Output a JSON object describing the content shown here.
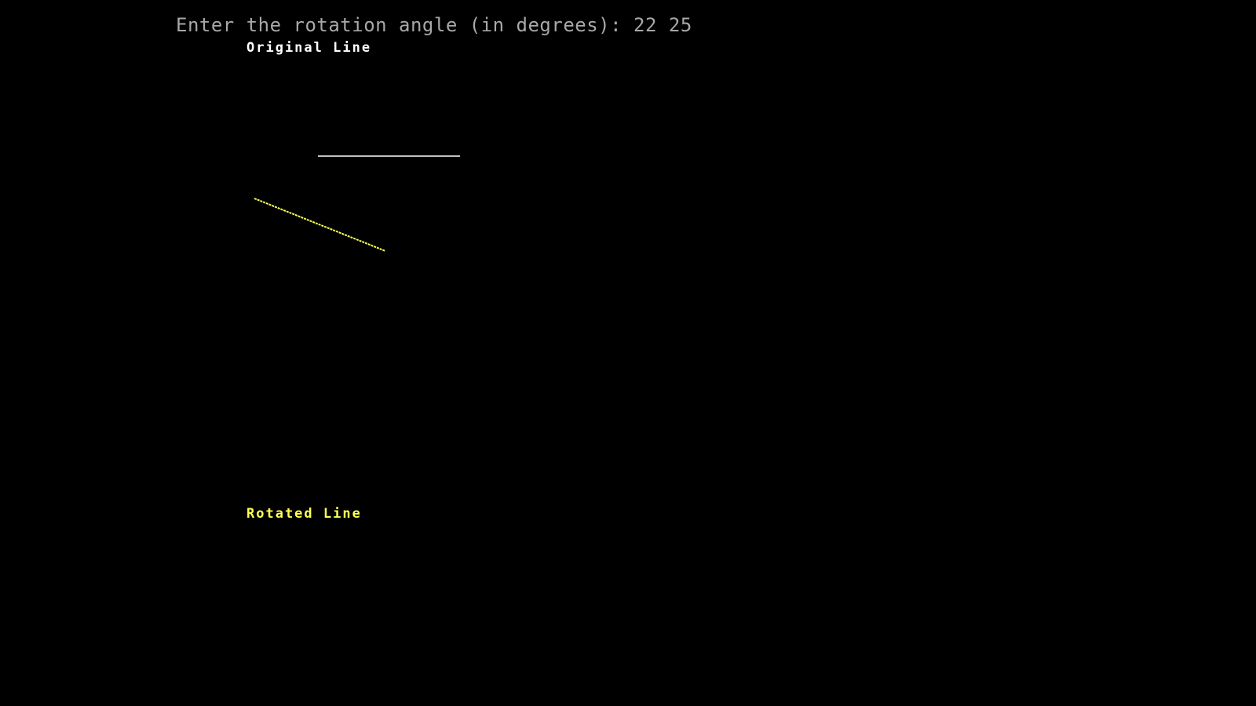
{
  "console": {
    "prompt_text": "Enter the rotation angle (in degrees): 22 25",
    "original_label": "Original Line",
    "rotated_label": "Rotated Line"
  },
  "colors": {
    "background": "#000000",
    "prompt": "#a8a8a8",
    "original_line": "#ffffff",
    "rotated_line": "#ffff55"
  }
}
